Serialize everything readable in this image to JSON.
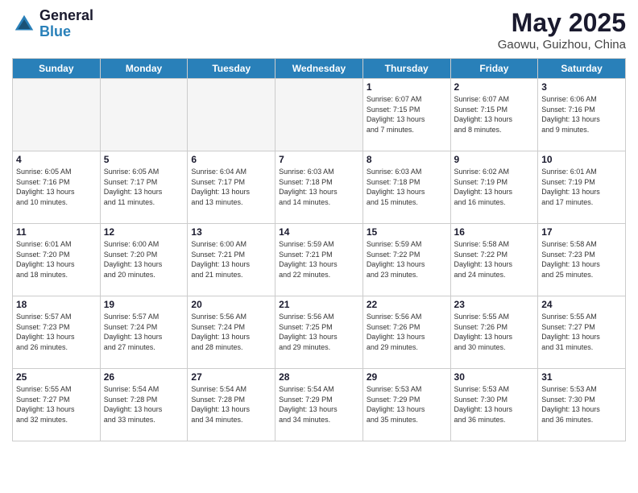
{
  "logo": {
    "general": "General",
    "blue": "Blue"
  },
  "title": {
    "month_year": "May 2025",
    "location": "Gaowu, Guizhou, China"
  },
  "days_of_week": [
    "Sunday",
    "Monday",
    "Tuesday",
    "Wednesday",
    "Thursday",
    "Friday",
    "Saturday"
  ],
  "weeks": [
    [
      {
        "day": "",
        "info": ""
      },
      {
        "day": "",
        "info": ""
      },
      {
        "day": "",
        "info": ""
      },
      {
        "day": "",
        "info": ""
      },
      {
        "day": "1",
        "info": "Sunrise: 6:07 AM\nSunset: 7:15 PM\nDaylight: 13 hours\nand 7 minutes."
      },
      {
        "day": "2",
        "info": "Sunrise: 6:07 AM\nSunset: 7:15 PM\nDaylight: 13 hours\nand 8 minutes."
      },
      {
        "day": "3",
        "info": "Sunrise: 6:06 AM\nSunset: 7:16 PM\nDaylight: 13 hours\nand 9 minutes."
      }
    ],
    [
      {
        "day": "4",
        "info": "Sunrise: 6:05 AM\nSunset: 7:16 PM\nDaylight: 13 hours\nand 10 minutes."
      },
      {
        "day": "5",
        "info": "Sunrise: 6:05 AM\nSunset: 7:17 PM\nDaylight: 13 hours\nand 11 minutes."
      },
      {
        "day": "6",
        "info": "Sunrise: 6:04 AM\nSunset: 7:17 PM\nDaylight: 13 hours\nand 13 minutes."
      },
      {
        "day": "7",
        "info": "Sunrise: 6:03 AM\nSunset: 7:18 PM\nDaylight: 13 hours\nand 14 minutes."
      },
      {
        "day": "8",
        "info": "Sunrise: 6:03 AM\nSunset: 7:18 PM\nDaylight: 13 hours\nand 15 minutes."
      },
      {
        "day": "9",
        "info": "Sunrise: 6:02 AM\nSunset: 7:19 PM\nDaylight: 13 hours\nand 16 minutes."
      },
      {
        "day": "10",
        "info": "Sunrise: 6:01 AM\nSunset: 7:19 PM\nDaylight: 13 hours\nand 17 minutes."
      }
    ],
    [
      {
        "day": "11",
        "info": "Sunrise: 6:01 AM\nSunset: 7:20 PM\nDaylight: 13 hours\nand 18 minutes."
      },
      {
        "day": "12",
        "info": "Sunrise: 6:00 AM\nSunset: 7:20 PM\nDaylight: 13 hours\nand 20 minutes."
      },
      {
        "day": "13",
        "info": "Sunrise: 6:00 AM\nSunset: 7:21 PM\nDaylight: 13 hours\nand 21 minutes."
      },
      {
        "day": "14",
        "info": "Sunrise: 5:59 AM\nSunset: 7:21 PM\nDaylight: 13 hours\nand 22 minutes."
      },
      {
        "day": "15",
        "info": "Sunrise: 5:59 AM\nSunset: 7:22 PM\nDaylight: 13 hours\nand 23 minutes."
      },
      {
        "day": "16",
        "info": "Sunrise: 5:58 AM\nSunset: 7:22 PM\nDaylight: 13 hours\nand 24 minutes."
      },
      {
        "day": "17",
        "info": "Sunrise: 5:58 AM\nSunset: 7:23 PM\nDaylight: 13 hours\nand 25 minutes."
      }
    ],
    [
      {
        "day": "18",
        "info": "Sunrise: 5:57 AM\nSunset: 7:23 PM\nDaylight: 13 hours\nand 26 minutes."
      },
      {
        "day": "19",
        "info": "Sunrise: 5:57 AM\nSunset: 7:24 PM\nDaylight: 13 hours\nand 27 minutes."
      },
      {
        "day": "20",
        "info": "Sunrise: 5:56 AM\nSunset: 7:24 PM\nDaylight: 13 hours\nand 28 minutes."
      },
      {
        "day": "21",
        "info": "Sunrise: 5:56 AM\nSunset: 7:25 PM\nDaylight: 13 hours\nand 29 minutes."
      },
      {
        "day": "22",
        "info": "Sunrise: 5:56 AM\nSunset: 7:26 PM\nDaylight: 13 hours\nand 29 minutes."
      },
      {
        "day": "23",
        "info": "Sunrise: 5:55 AM\nSunset: 7:26 PM\nDaylight: 13 hours\nand 30 minutes."
      },
      {
        "day": "24",
        "info": "Sunrise: 5:55 AM\nSunset: 7:27 PM\nDaylight: 13 hours\nand 31 minutes."
      }
    ],
    [
      {
        "day": "25",
        "info": "Sunrise: 5:55 AM\nSunset: 7:27 PM\nDaylight: 13 hours\nand 32 minutes."
      },
      {
        "day": "26",
        "info": "Sunrise: 5:54 AM\nSunset: 7:28 PM\nDaylight: 13 hours\nand 33 minutes."
      },
      {
        "day": "27",
        "info": "Sunrise: 5:54 AM\nSunset: 7:28 PM\nDaylight: 13 hours\nand 34 minutes."
      },
      {
        "day": "28",
        "info": "Sunrise: 5:54 AM\nSunset: 7:29 PM\nDaylight: 13 hours\nand 34 minutes."
      },
      {
        "day": "29",
        "info": "Sunrise: 5:53 AM\nSunset: 7:29 PM\nDaylight: 13 hours\nand 35 minutes."
      },
      {
        "day": "30",
        "info": "Sunrise: 5:53 AM\nSunset: 7:30 PM\nDaylight: 13 hours\nand 36 minutes."
      },
      {
        "day": "31",
        "info": "Sunrise: 5:53 AM\nSunset: 7:30 PM\nDaylight: 13 hours\nand 36 minutes."
      }
    ]
  ]
}
